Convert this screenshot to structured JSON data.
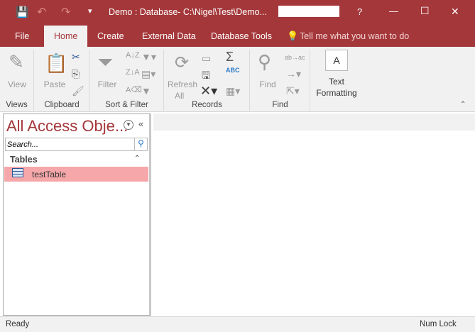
{
  "window": {
    "title": "Demo : Database- C:\\Nigel\\Test\\Demo...",
    "help": "?",
    "minimize": "—",
    "maximize": "☐",
    "close": "✕"
  },
  "tabs": [
    {
      "label": "File"
    },
    {
      "label": "Home"
    },
    {
      "label": "Create"
    },
    {
      "label": "External Data"
    },
    {
      "label": "Database Tools"
    }
  ],
  "tell_me": "Tell me what you want to do",
  "ribbon": {
    "views": {
      "label": "Views",
      "view": "View"
    },
    "clipboard": {
      "label": "Clipboard",
      "paste": "Paste"
    },
    "sort_filter": {
      "label": "Sort & Filter",
      "filter": "Filter"
    },
    "records": {
      "label": "Records",
      "refresh": "Refresh",
      "all": "All",
      "sigma": "Σ",
      "abc": "ABC"
    },
    "find": {
      "label": "Find",
      "find": "Find",
      "replace": "ab→ac"
    },
    "text": {
      "label1": "Text",
      "label2": "Formatting",
      "glyph": "A"
    }
  },
  "nav": {
    "title": "All Access Obje...",
    "search_placeholder": "Search...",
    "section": "Tables",
    "items": [
      {
        "label": "testTable"
      }
    ]
  },
  "status": {
    "left": "Ready",
    "right": "Num Lock"
  },
  "colors": {
    "accent": "#a4373a",
    "selected": "#f6a7aa"
  }
}
